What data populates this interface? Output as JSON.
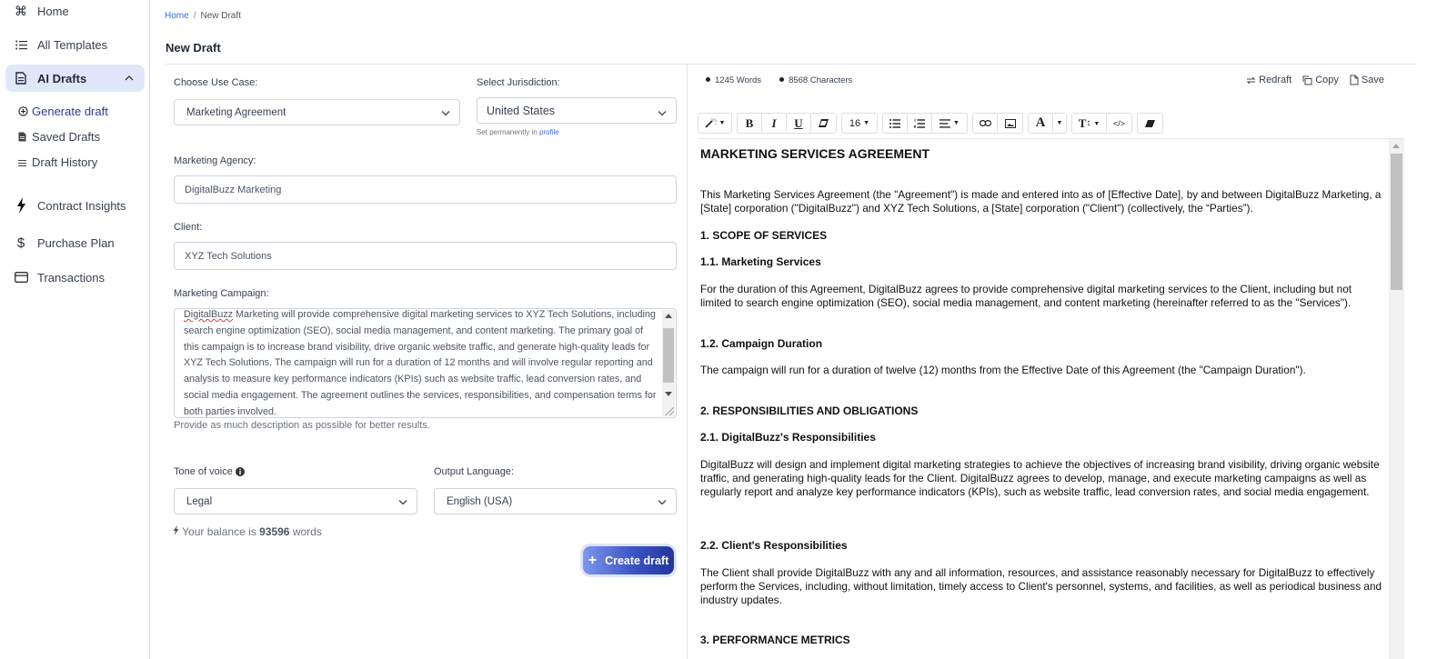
{
  "sidebar": {
    "items": [
      {
        "label": "Home",
        "icon": "command-icon"
      },
      {
        "label": "All Templates",
        "icon": "list-icon"
      },
      {
        "label": "AI Drafts",
        "icon": "document-icon",
        "expanded": true
      },
      {
        "label": "Contract Insights",
        "icon": "bolt-icon"
      },
      {
        "label": "Purchase Plan",
        "icon": "dollar-icon"
      },
      {
        "label": "Transactions",
        "icon": "credit-card-icon"
      }
    ],
    "sub_items": [
      {
        "label": "Generate draft",
        "icon": "plus-circle-icon",
        "active": true
      },
      {
        "label": "Saved Drafts",
        "icon": "file-icon"
      },
      {
        "label": "Draft History",
        "icon": "menu-icon"
      }
    ]
  },
  "breadcrumb": {
    "home": "Home",
    "separator": "/",
    "current": "New Draft"
  },
  "page_title": "New Draft",
  "form": {
    "use_case": {
      "label": "Choose Use Case:",
      "value": "Marketing Agreement"
    },
    "jurisdiction": {
      "label": "Select Jurisdiction:",
      "value": "United States",
      "hint_prefix": "Set permanently in",
      "hint_link": "profile"
    },
    "agency": {
      "label": "Marketing Agency:",
      "value": "DigitalBuzz Marketing"
    },
    "client": {
      "label": "Client:",
      "value": "XYZ Tech Solutions"
    },
    "campaign": {
      "label": "Marketing Campaign:",
      "first_word": "DigitalBuzz",
      "value_rest": " Marketing will provide comprehensive digital marketing services to XYZ Tech Solutions, including search engine optimization (SEO), social media management, and content marketing. The primary goal of this campaign is to increase brand visibility, drive organic website traffic, and generate high-quality leads for XYZ Tech Solutions. The campaign will run for a duration of 12 months and will involve regular reporting and analysis to measure key performance indicators (KPIs) such as website traffic, lead conversion rates, and social media engagement. The agreement outlines the services, responsibilities, and compensation terms for both parties involved.",
      "hint": "Provide as much description as possible for better results."
    },
    "tone": {
      "label": "Tone of voice",
      "value": "Legal"
    },
    "language": {
      "label": "Output Language:",
      "value": "English (USA)"
    },
    "balance": {
      "prefix": "Your balance is",
      "amount": "93596",
      "suffix": "words"
    },
    "create_button": "Create draft"
  },
  "editor": {
    "words": "1245 Words",
    "characters": "8568 Characters",
    "actions": {
      "redraft": "Redraft",
      "copy": "Copy",
      "save": "Save"
    },
    "toolbar": {
      "font_size": "16"
    },
    "document": {
      "title": "MARKETING SERVICES AGREEMENT",
      "intro": "This Marketing Services Agreement (the \"Agreement\") is made and entered into as of [Effective Date], by and between DigitalBuzz Marketing, a [State] corporation (\"DigitalBuzz\") and XYZ Tech Solutions, a [State] corporation (\"Client\") (collectively, the “Parties”).",
      "s1": "1. SCOPE OF SERVICES",
      "s1_1": "1.1. Marketing Services",
      "s1_1_text": "For the duration of this Agreement, DigitalBuzz agrees to provide comprehensive digital marketing services to the Client, including but not limited to search engine optimization (SEO), social media management, and content marketing (hereinafter referred to as the \"Services\").",
      "s1_2": "1.2. Campaign Duration",
      "s1_2_text": "The campaign will run for a duration of twelve (12) months from the Effective Date of this Agreement (the \"Campaign Duration\").",
      "s2": "2. RESPONSIBILITIES AND OBLIGATIONS",
      "s2_1": "2.1. DigitalBuzz's Responsibilities",
      "s2_1_text": "DigitalBuzz will design and implement digital marketing strategies to achieve the objectives of increasing brand visibility, driving organic website traffic, and generating high-quality leads for the Client. DigitalBuzz agrees to develop, manage, and execute marketing campaigns as well as regularly report and analyze key performance indicators (KPIs), such as website traffic, lead conversion rates, and social media engagement.",
      "s2_2": "2.2. Client's Responsibilities",
      "s2_2_text": "The Client shall provide DigitalBuzz with any and all information, resources, and assistance reasonably necessary for DigitalBuzz to effectively perform the Services, including, without limitation, timely access to Client's personnel, systems, and facilities, as well as periodical business and industry updates.",
      "s3": "3. PERFORMANCE METRICS"
    }
  }
}
